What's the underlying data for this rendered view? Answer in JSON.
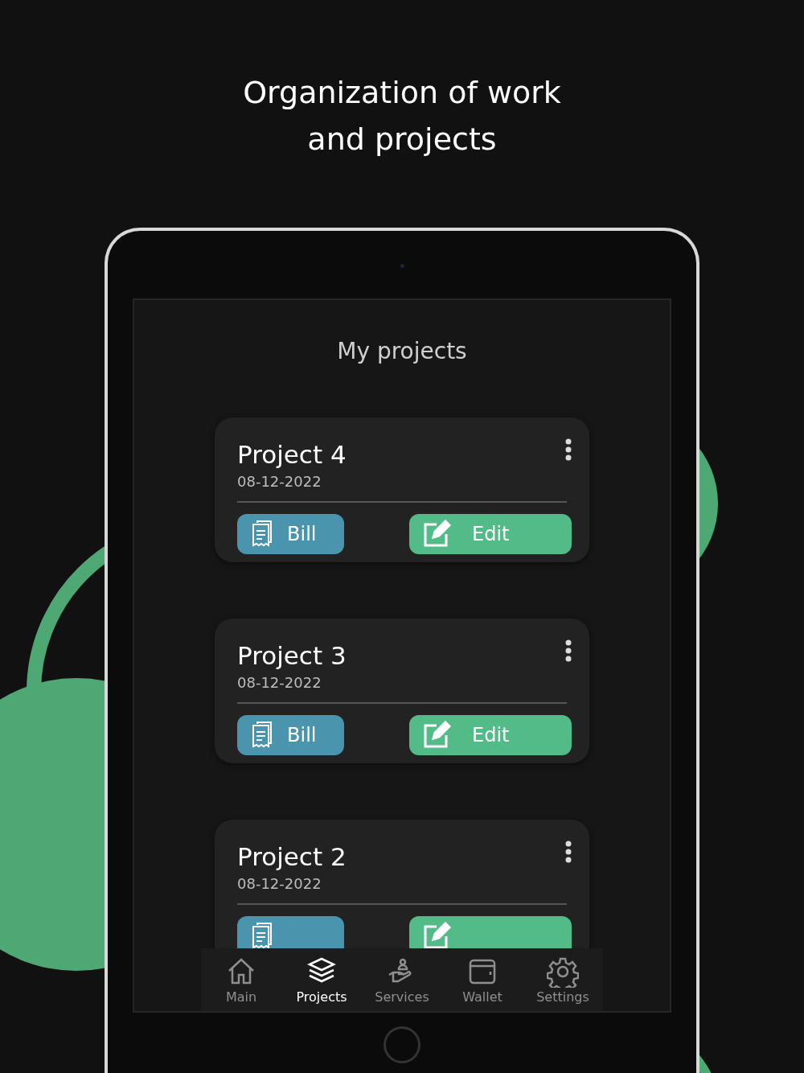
{
  "headline": [
    "Organization of work",
    "and projects"
  ],
  "screen": {
    "title": "My projects",
    "projects": [
      {
        "name": "Project 4",
        "date": "08-12-2022",
        "buttons": [
          {
            "kind": "bill",
            "label": "Bill"
          },
          {
            "kind": "edit",
            "label": "Edit"
          }
        ]
      },
      {
        "name": "Project 3",
        "date": "08-12-2022",
        "buttons": [
          {
            "kind": "bill",
            "label": "Bill"
          },
          {
            "kind": "edit",
            "label": "Edit"
          }
        ]
      },
      {
        "name": "Project 2",
        "date": "08-12-2022",
        "buttons": [
          {
            "kind": "bill"
          },
          {
            "kind": "edit"
          }
        ]
      }
    ],
    "nav": [
      {
        "kind": "home",
        "label": "Main",
        "selected": false
      },
      {
        "kind": "layers",
        "label": "Projects",
        "selected": true
      },
      {
        "kind": "services",
        "label": "Services",
        "selected": false
      },
      {
        "kind": "wallet",
        "label": "Wallet",
        "selected": false
      },
      {
        "kind": "settings",
        "label": "Settings",
        "selected": false
      }
    ]
  }
}
